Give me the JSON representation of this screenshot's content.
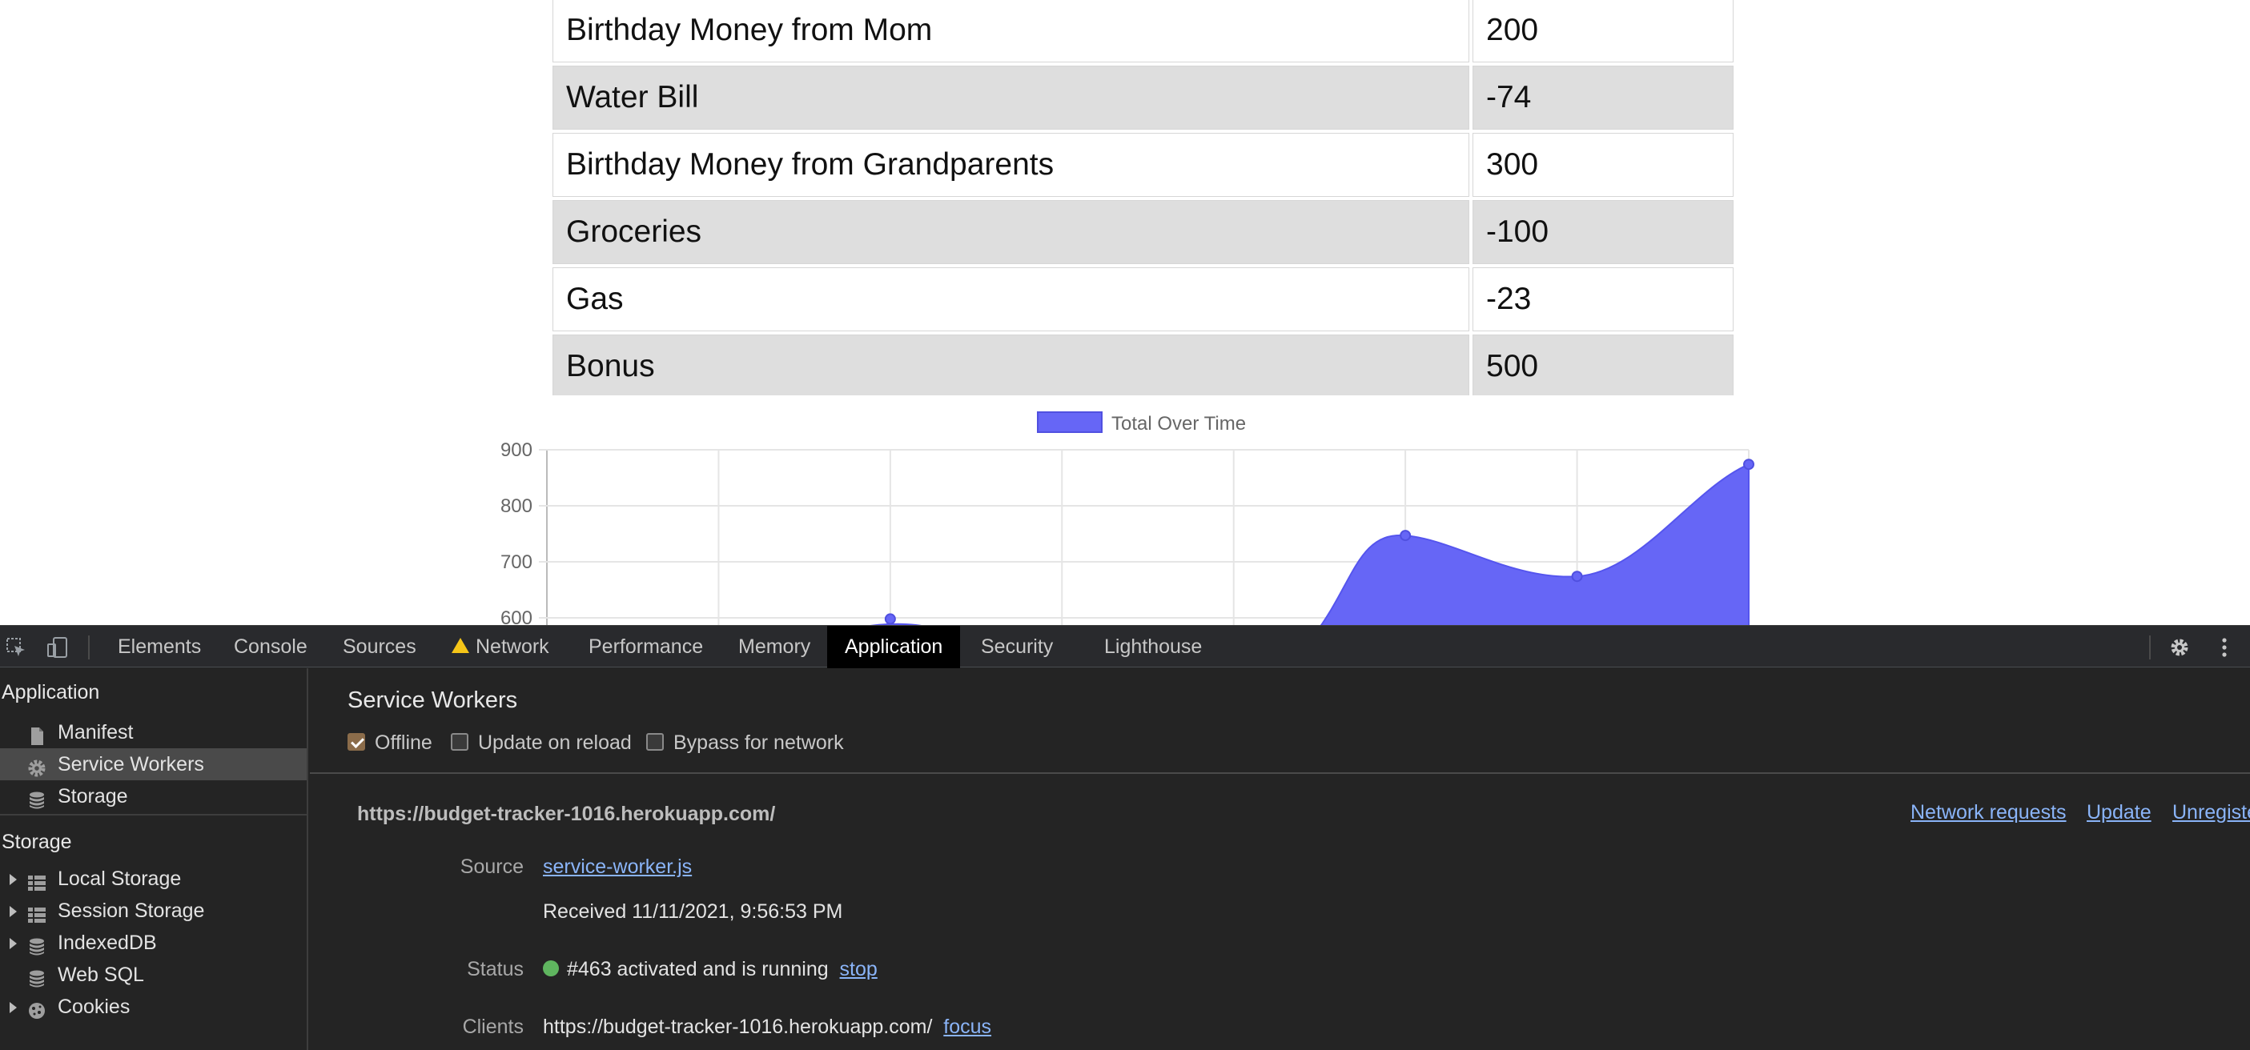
{
  "transactions": [
    {
      "name": "Birthday Money from Mom",
      "amount": "200"
    },
    {
      "name": "Water Bill",
      "amount": "-74"
    },
    {
      "name": "Birthday Money from Grandparents",
      "amount": "300"
    },
    {
      "name": "Groceries",
      "amount": "-100"
    },
    {
      "name": "Gas",
      "amount": "-23"
    },
    {
      "name": "Bonus",
      "amount": "500"
    },
    {
      "name": "",
      "amount": ""
    }
  ],
  "chart_data": {
    "type": "area",
    "legend": "Total Over Time",
    "legend_position": "top",
    "grid": true,
    "color": "#6666f6",
    "y_ticks": [
      900,
      800,
      700,
      600
    ],
    "ylim": [
      600,
      900
    ],
    "points_visible": [
      {
        "index": 2,
        "value": 598
      },
      {
        "index": 5,
        "value": 747
      },
      {
        "index": 6,
        "value": 674
      },
      {
        "index": 7,
        "value": 874
      }
    ],
    "x_count": 8
  },
  "devtools": {
    "tabs": [
      {
        "label": "Elements",
        "active": false
      },
      {
        "label": "Console",
        "active": false
      },
      {
        "label": "Sources",
        "active": false
      },
      {
        "label": "Network",
        "active": false,
        "warning": true
      },
      {
        "label": "Performance",
        "active": false
      },
      {
        "label": "Memory",
        "active": false
      },
      {
        "label": "Application",
        "active": true
      },
      {
        "label": "Security",
        "active": false
      },
      {
        "label": "Lighthouse",
        "active": false
      }
    ],
    "sidebar": {
      "application_heading": "Application",
      "application_items": [
        {
          "label": "Manifest",
          "icon": "file-icon"
        },
        {
          "label": "Service Workers",
          "icon": "gear-icon",
          "selected": true
        },
        {
          "label": "Storage",
          "icon": "database-icon"
        }
      ],
      "storage_heading": "Storage",
      "storage_items": [
        {
          "label": "Local Storage",
          "icon": "grid-icon",
          "expandable": true
        },
        {
          "label": "Session Storage",
          "icon": "grid-icon",
          "expandable": true
        },
        {
          "label": "IndexedDB",
          "icon": "database-icon",
          "expandable": true
        },
        {
          "label": "Web SQL",
          "icon": "database-icon",
          "expandable": false
        },
        {
          "label": "Cookies",
          "icon": "cookie-icon",
          "expandable": true
        }
      ]
    },
    "service_workers": {
      "title": "Service Workers",
      "checkboxes": [
        {
          "label": "Offline",
          "checked": true
        },
        {
          "label": "Update on reload",
          "checked": false
        },
        {
          "label": "Bypass for network",
          "checked": false
        }
      ],
      "origin": "https://budget-tracker-1016.herokuapp.com/",
      "links": {
        "network_requests": "Network requests",
        "update": "Update",
        "unregister": "Unregister"
      },
      "source_label": "Source",
      "source_value": "service-worker.js",
      "received": "Received 11/11/2021, 9:56:53 PM",
      "status_label": "Status",
      "status_text": "#463 activated and is running",
      "status_link": "stop",
      "status_color": "#5fb55f",
      "clients_label": "Clients",
      "clients_value": "https://budget-tracker-1016.herokuapp.com/",
      "clients_link": "focus"
    }
  }
}
